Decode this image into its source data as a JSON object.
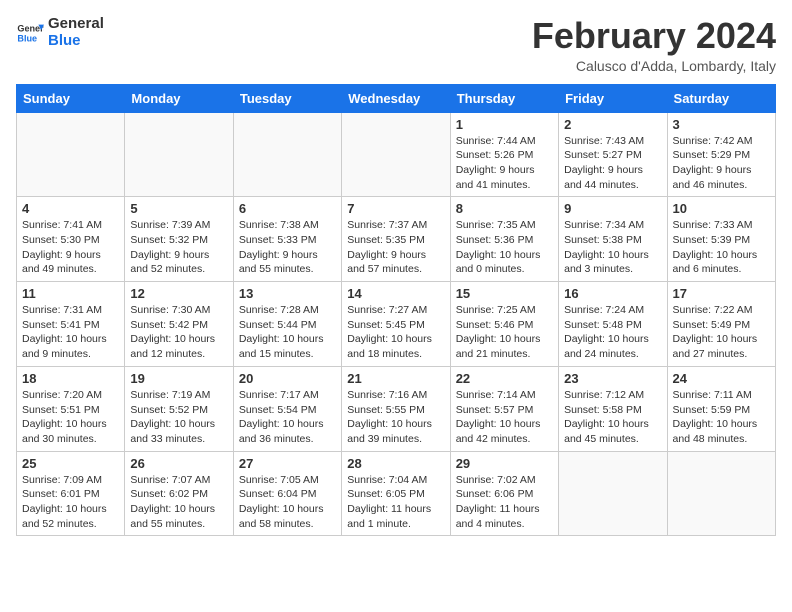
{
  "logo": {
    "text_general": "General",
    "text_blue": "Blue"
  },
  "header": {
    "month_title": "February 2024",
    "location": "Calusco d'Adda, Lombardy, Italy"
  },
  "weekdays": [
    "Sunday",
    "Monday",
    "Tuesday",
    "Wednesday",
    "Thursday",
    "Friday",
    "Saturday"
  ],
  "weeks": [
    [
      {
        "day": "",
        "info": ""
      },
      {
        "day": "",
        "info": ""
      },
      {
        "day": "",
        "info": ""
      },
      {
        "day": "",
        "info": ""
      },
      {
        "day": "1",
        "info": "Sunrise: 7:44 AM\nSunset: 5:26 PM\nDaylight: 9 hours\nand 41 minutes."
      },
      {
        "day": "2",
        "info": "Sunrise: 7:43 AM\nSunset: 5:27 PM\nDaylight: 9 hours\nand 44 minutes."
      },
      {
        "day": "3",
        "info": "Sunrise: 7:42 AM\nSunset: 5:29 PM\nDaylight: 9 hours\nand 46 minutes."
      }
    ],
    [
      {
        "day": "4",
        "info": "Sunrise: 7:41 AM\nSunset: 5:30 PM\nDaylight: 9 hours\nand 49 minutes."
      },
      {
        "day": "5",
        "info": "Sunrise: 7:39 AM\nSunset: 5:32 PM\nDaylight: 9 hours\nand 52 minutes."
      },
      {
        "day": "6",
        "info": "Sunrise: 7:38 AM\nSunset: 5:33 PM\nDaylight: 9 hours\nand 55 minutes."
      },
      {
        "day": "7",
        "info": "Sunrise: 7:37 AM\nSunset: 5:35 PM\nDaylight: 9 hours\nand 57 minutes."
      },
      {
        "day": "8",
        "info": "Sunrise: 7:35 AM\nSunset: 5:36 PM\nDaylight: 10 hours\nand 0 minutes."
      },
      {
        "day": "9",
        "info": "Sunrise: 7:34 AM\nSunset: 5:38 PM\nDaylight: 10 hours\nand 3 minutes."
      },
      {
        "day": "10",
        "info": "Sunrise: 7:33 AM\nSunset: 5:39 PM\nDaylight: 10 hours\nand 6 minutes."
      }
    ],
    [
      {
        "day": "11",
        "info": "Sunrise: 7:31 AM\nSunset: 5:41 PM\nDaylight: 10 hours\nand 9 minutes."
      },
      {
        "day": "12",
        "info": "Sunrise: 7:30 AM\nSunset: 5:42 PM\nDaylight: 10 hours\nand 12 minutes."
      },
      {
        "day": "13",
        "info": "Sunrise: 7:28 AM\nSunset: 5:44 PM\nDaylight: 10 hours\nand 15 minutes."
      },
      {
        "day": "14",
        "info": "Sunrise: 7:27 AM\nSunset: 5:45 PM\nDaylight: 10 hours\nand 18 minutes."
      },
      {
        "day": "15",
        "info": "Sunrise: 7:25 AM\nSunset: 5:46 PM\nDaylight: 10 hours\nand 21 minutes."
      },
      {
        "day": "16",
        "info": "Sunrise: 7:24 AM\nSunset: 5:48 PM\nDaylight: 10 hours\nand 24 minutes."
      },
      {
        "day": "17",
        "info": "Sunrise: 7:22 AM\nSunset: 5:49 PM\nDaylight: 10 hours\nand 27 minutes."
      }
    ],
    [
      {
        "day": "18",
        "info": "Sunrise: 7:20 AM\nSunset: 5:51 PM\nDaylight: 10 hours\nand 30 minutes."
      },
      {
        "day": "19",
        "info": "Sunrise: 7:19 AM\nSunset: 5:52 PM\nDaylight: 10 hours\nand 33 minutes."
      },
      {
        "day": "20",
        "info": "Sunrise: 7:17 AM\nSunset: 5:54 PM\nDaylight: 10 hours\nand 36 minutes."
      },
      {
        "day": "21",
        "info": "Sunrise: 7:16 AM\nSunset: 5:55 PM\nDaylight: 10 hours\nand 39 minutes."
      },
      {
        "day": "22",
        "info": "Sunrise: 7:14 AM\nSunset: 5:57 PM\nDaylight: 10 hours\nand 42 minutes."
      },
      {
        "day": "23",
        "info": "Sunrise: 7:12 AM\nSunset: 5:58 PM\nDaylight: 10 hours\nand 45 minutes."
      },
      {
        "day": "24",
        "info": "Sunrise: 7:11 AM\nSunset: 5:59 PM\nDaylight: 10 hours\nand 48 minutes."
      }
    ],
    [
      {
        "day": "25",
        "info": "Sunrise: 7:09 AM\nSunset: 6:01 PM\nDaylight: 10 hours\nand 52 minutes."
      },
      {
        "day": "26",
        "info": "Sunrise: 7:07 AM\nSunset: 6:02 PM\nDaylight: 10 hours\nand 55 minutes."
      },
      {
        "day": "27",
        "info": "Sunrise: 7:05 AM\nSunset: 6:04 PM\nDaylight: 10 hours\nand 58 minutes."
      },
      {
        "day": "28",
        "info": "Sunrise: 7:04 AM\nSunset: 6:05 PM\nDaylight: 11 hours\nand 1 minute."
      },
      {
        "day": "29",
        "info": "Sunrise: 7:02 AM\nSunset: 6:06 PM\nDaylight: 11 hours\nand 4 minutes."
      },
      {
        "day": "",
        "info": ""
      },
      {
        "day": "",
        "info": ""
      }
    ]
  ]
}
